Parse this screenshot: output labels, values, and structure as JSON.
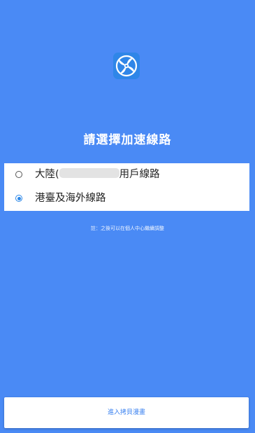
{
  "logo": {
    "icon": "turbine-icon",
    "bg_color": "#2f86e8"
  },
  "title": "請選擇加速線路",
  "options": [
    {
      "label_prefix": "大陸(",
      "label_suffix": "用戶線路",
      "checked": false
    },
    {
      "label": "港臺及海外線路",
      "checked": true
    }
  ],
  "note": "註：之後可以在個人中心繼續調整",
  "enter_button": "進入拷貝漫畫",
  "colors": {
    "background": "#4a8af5",
    "accent": "#2a87e8",
    "button_text": "#3b82f0"
  }
}
